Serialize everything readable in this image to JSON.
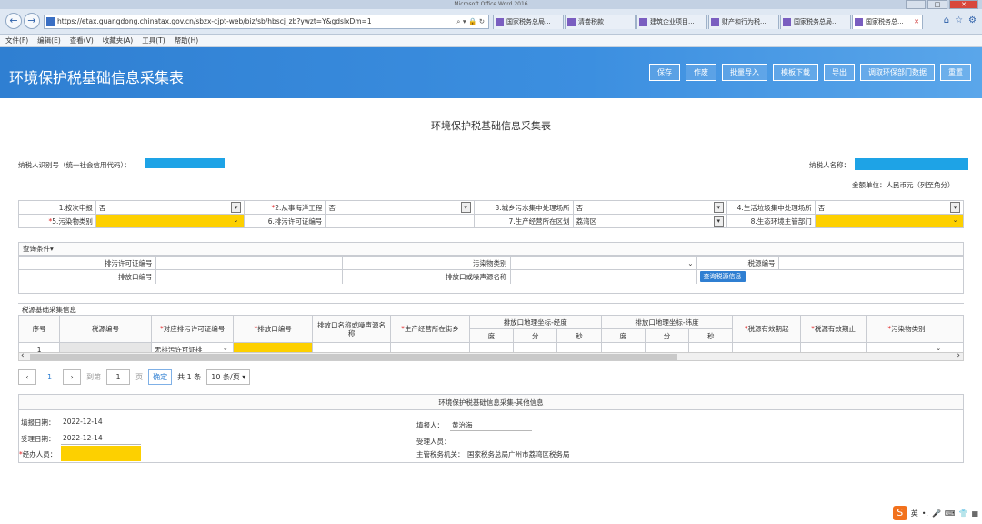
{
  "window": {
    "title": "Microsoft Office Word 2016"
  },
  "browser": {
    "url": "https://etax.guangdong.chinatax.gov.cn/sbzx-cjpt-web/biz/sb/hbscj_zb?ywzt=Y&gdslxDm=1",
    "tabs": [
      {
        "label": "国家税务总局..."
      },
      {
        "label": "清卷税款"
      },
      {
        "label": "建筑企业项目..."
      },
      {
        "label": "财产和行为税..."
      },
      {
        "label": "国家税务总局..."
      },
      {
        "label": "国家税务总..."
      }
    ],
    "menu": [
      "文件(F)",
      "编辑(E)",
      "查看(V)",
      "收藏夹(A)",
      "工具(T)",
      "帮助(H)"
    ]
  },
  "header": {
    "title": "环境保护税基础信息采集表",
    "buttons": [
      "保存",
      "作废",
      "批量导入",
      "模板下载",
      "导出",
      "调取环保部门数据",
      "重置"
    ]
  },
  "doc": {
    "title": "环境保护税基础信息采集表",
    "taxpayer_id_label": "纳税人识别号（统一社会信用代码）：",
    "taxpayer_name_label": "纳税人名称：",
    "unit_label": "金额单位：人民币元（列至角分）"
  },
  "form1": {
    "r1": [
      {
        "label": "1.按次申报",
        "value": "否",
        "req": ""
      },
      {
        "label": "2.从事海洋工程",
        "value": "否",
        "req": "*"
      },
      {
        "label": "3.城乡污水集中处理场所",
        "value": "否",
        "req": ""
      },
      {
        "label": "4.生活垃圾集中处理场所",
        "value": "否",
        "req": ""
      }
    ],
    "r2": [
      {
        "label": "5.污染物类别",
        "value": "",
        "req": "*"
      },
      {
        "label": "6.排污许可证编号",
        "value": "",
        "req": ""
      },
      {
        "label": "7.生产经营所在区划",
        "value": "荔湾区",
        "req": ""
      },
      {
        "label": "8.生态环境主管部门",
        "value": "",
        "req": ""
      }
    ]
  },
  "query": {
    "title": "查询条件▾",
    "f1": "排污许可证编号",
    "f2": "污染物类别",
    "f3": "税源编号",
    "f4": "排放口编号",
    "f5": "排放口或噪声源名称",
    "button": "查询税源信息"
  },
  "grid": {
    "section": "税源基础采集信息",
    "headers": {
      "seq": "序号",
      "taxsrc": "税源编号",
      "permit": "对应排污许可证编号",
      "outlet": "排放口编号",
      "name": "排放口名称或噪声源名称",
      "street": "生产经营所在街乡",
      "lng": "排放口地理坐标-经度",
      "lat": "排放口地理坐标-纬度",
      "deg": "度",
      "min": "分",
      "sec": "秒",
      "start": "税源有效期起",
      "end": "税源有效期止",
      "pollutant": "污染物类别"
    },
    "row": {
      "seq": "1",
      "permit": "无排污许可证排"
    }
  },
  "pager": {
    "page": "1",
    "goto_label": "到第",
    "goto_value": "1",
    "page_unit": "页",
    "confirm": "确定",
    "total": "共 1 条",
    "page_size": "10 条/页"
  },
  "info": {
    "title": "环境保护税基础信息采集-其他信息",
    "fill_date_label": "填报日期：",
    "fill_date": "2022-12-14",
    "accept_date_label": "受理日期：",
    "accept_date": "2022-12-14",
    "agent_label": "经办人员：",
    "filler_label": "填报人：",
    "filler": "黄治海",
    "acceptor_label": "受理人员：",
    "authority_label": "主管税务机关：",
    "authority": "国家税务总局广州市荔湾区税务局"
  },
  "tray": {
    "ime": "英"
  }
}
